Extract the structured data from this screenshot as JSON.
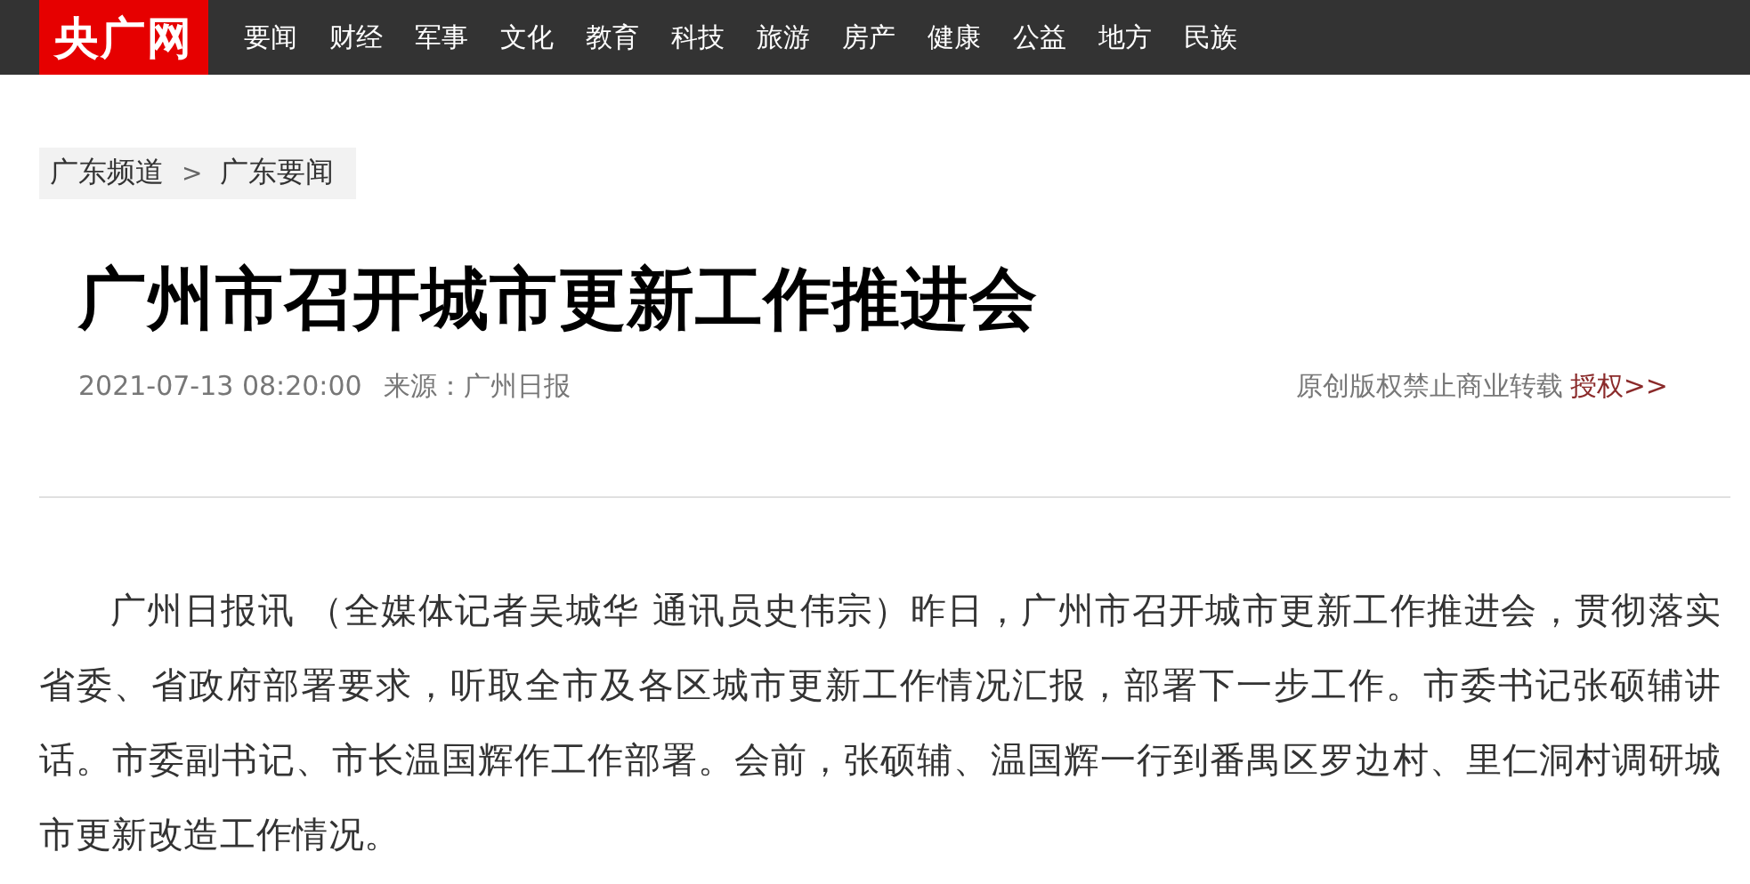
{
  "header": {
    "logo": "央广网",
    "nav": [
      "要闻",
      "财经",
      "军事",
      "文化",
      "教育",
      "科技",
      "旅游",
      "房产",
      "健康",
      "公益",
      "地方",
      "民族"
    ]
  },
  "breadcrumb": {
    "items": [
      "广东频道",
      "广东要闻"
    ],
    "separator": ">"
  },
  "article": {
    "title": "广州市召开城市更新工作推进会",
    "date": "2021-07-13 08:20:00",
    "source": "来源：广州日报",
    "copyright": "原创版权禁止商业转载",
    "license_link": "授权>>",
    "paragraphs": [
      "广州日报讯 （全媒体记者吴城华 通讯员史伟宗）昨日，广州市召开城市更新工作推进会，贯彻落实省委、省政府部署要求，听取全市及各区城市更新工作情况汇报，部署下一步工作。市委书记张硕辅讲话。市委副书记、市长温国辉作工作部署。会前，张硕辅、温国辉一行到番禺区罗边村、里仁洞村调研城市更新改造工作情况。"
    ]
  }
}
